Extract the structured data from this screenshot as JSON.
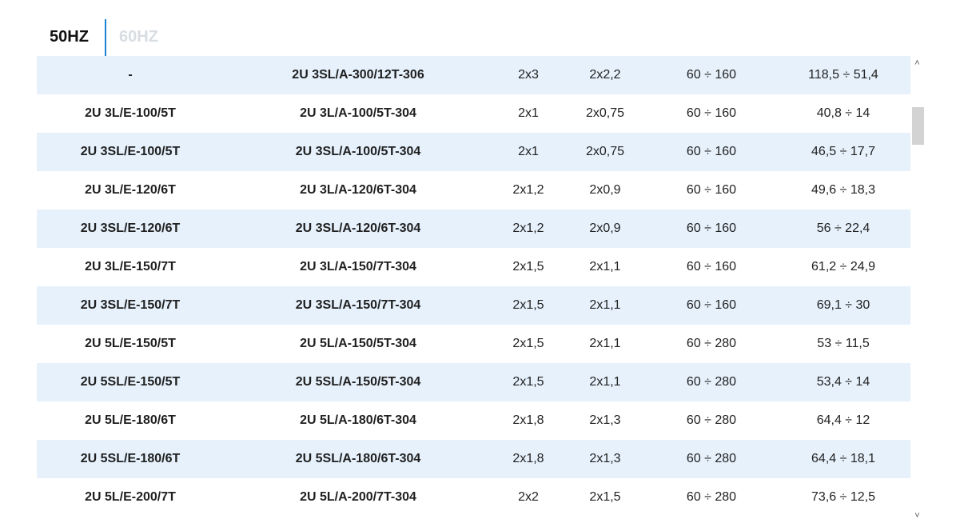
{
  "tabs": {
    "hz50": "50HZ",
    "hz60": "60HZ",
    "active": "50HZ"
  },
  "rows": [
    [
      "-",
      "2U 3SL/A-300/12T-306",
      "2x3",
      "2x2,2",
      "60 ÷ 160",
      "118,5 ÷ 51,4"
    ],
    [
      "2U 3L/E-100/5T",
      "2U 3L/A-100/5T-304",
      "2x1",
      "2x0,75",
      "60 ÷ 160",
      "40,8 ÷ 14"
    ],
    [
      "2U 3SL/E-100/5T",
      "2U 3SL/A-100/5T-304",
      "2x1",
      "2x0,75",
      "60 ÷ 160",
      "46,5 ÷ 17,7"
    ],
    [
      "2U 3L/E-120/6T",
      "2U 3L/A-120/6T-304",
      "2x1,2",
      "2x0,9",
      "60 ÷ 160",
      "49,6 ÷ 18,3"
    ],
    [
      "2U 3SL/E-120/6T",
      "2U 3SL/A-120/6T-304",
      "2x1,2",
      "2x0,9",
      "60 ÷ 160",
      "56 ÷ 22,4"
    ],
    [
      "2U 3L/E-150/7T",
      "2U 3L/A-150/7T-304",
      "2x1,5",
      "2x1,1",
      "60 ÷ 160",
      "61,2 ÷ 24,9"
    ],
    [
      "2U 3SL/E-150/7T",
      "2U 3SL/A-150/7T-304",
      "2x1,5",
      "2x1,1",
      "60 ÷ 160",
      "69,1 ÷ 30"
    ],
    [
      "2U 5L/E-150/5T",
      "2U 5L/A-150/5T-304",
      "2x1,5",
      "2x1,1",
      "60 ÷ 280",
      "53 ÷ 11,5"
    ],
    [
      "2U 5SL/E-150/5T",
      "2U 5SL/A-150/5T-304",
      "2x1,5",
      "2x1,1",
      "60 ÷ 280",
      "53,4 ÷ 14"
    ],
    [
      "2U 5L/E-180/6T",
      "2U 5L/A-180/6T-304",
      "2x1,8",
      "2x1,3",
      "60 ÷ 280",
      "64,4 ÷ 12"
    ],
    [
      "2U 5SL/E-180/6T",
      "2U 5SL/A-180/6T-304",
      "2x1,8",
      "2x1,3",
      "60 ÷ 280",
      "64,4 ÷ 18,1"
    ],
    [
      "2U 5L/E-200/7T",
      "2U 5L/A-200/7T-304",
      "2x2",
      "2x1,5",
      "60 ÷ 280",
      "73,6 ÷ 12,5"
    ]
  ],
  "icons": {
    "scroll_up": "chevron-up-icon",
    "scroll_down": "chevron-down-icon"
  },
  "colors": {
    "accent": "#1a82d1",
    "row_alt": "#e6f1fc",
    "inactive_tab": "#d8dde2"
  }
}
